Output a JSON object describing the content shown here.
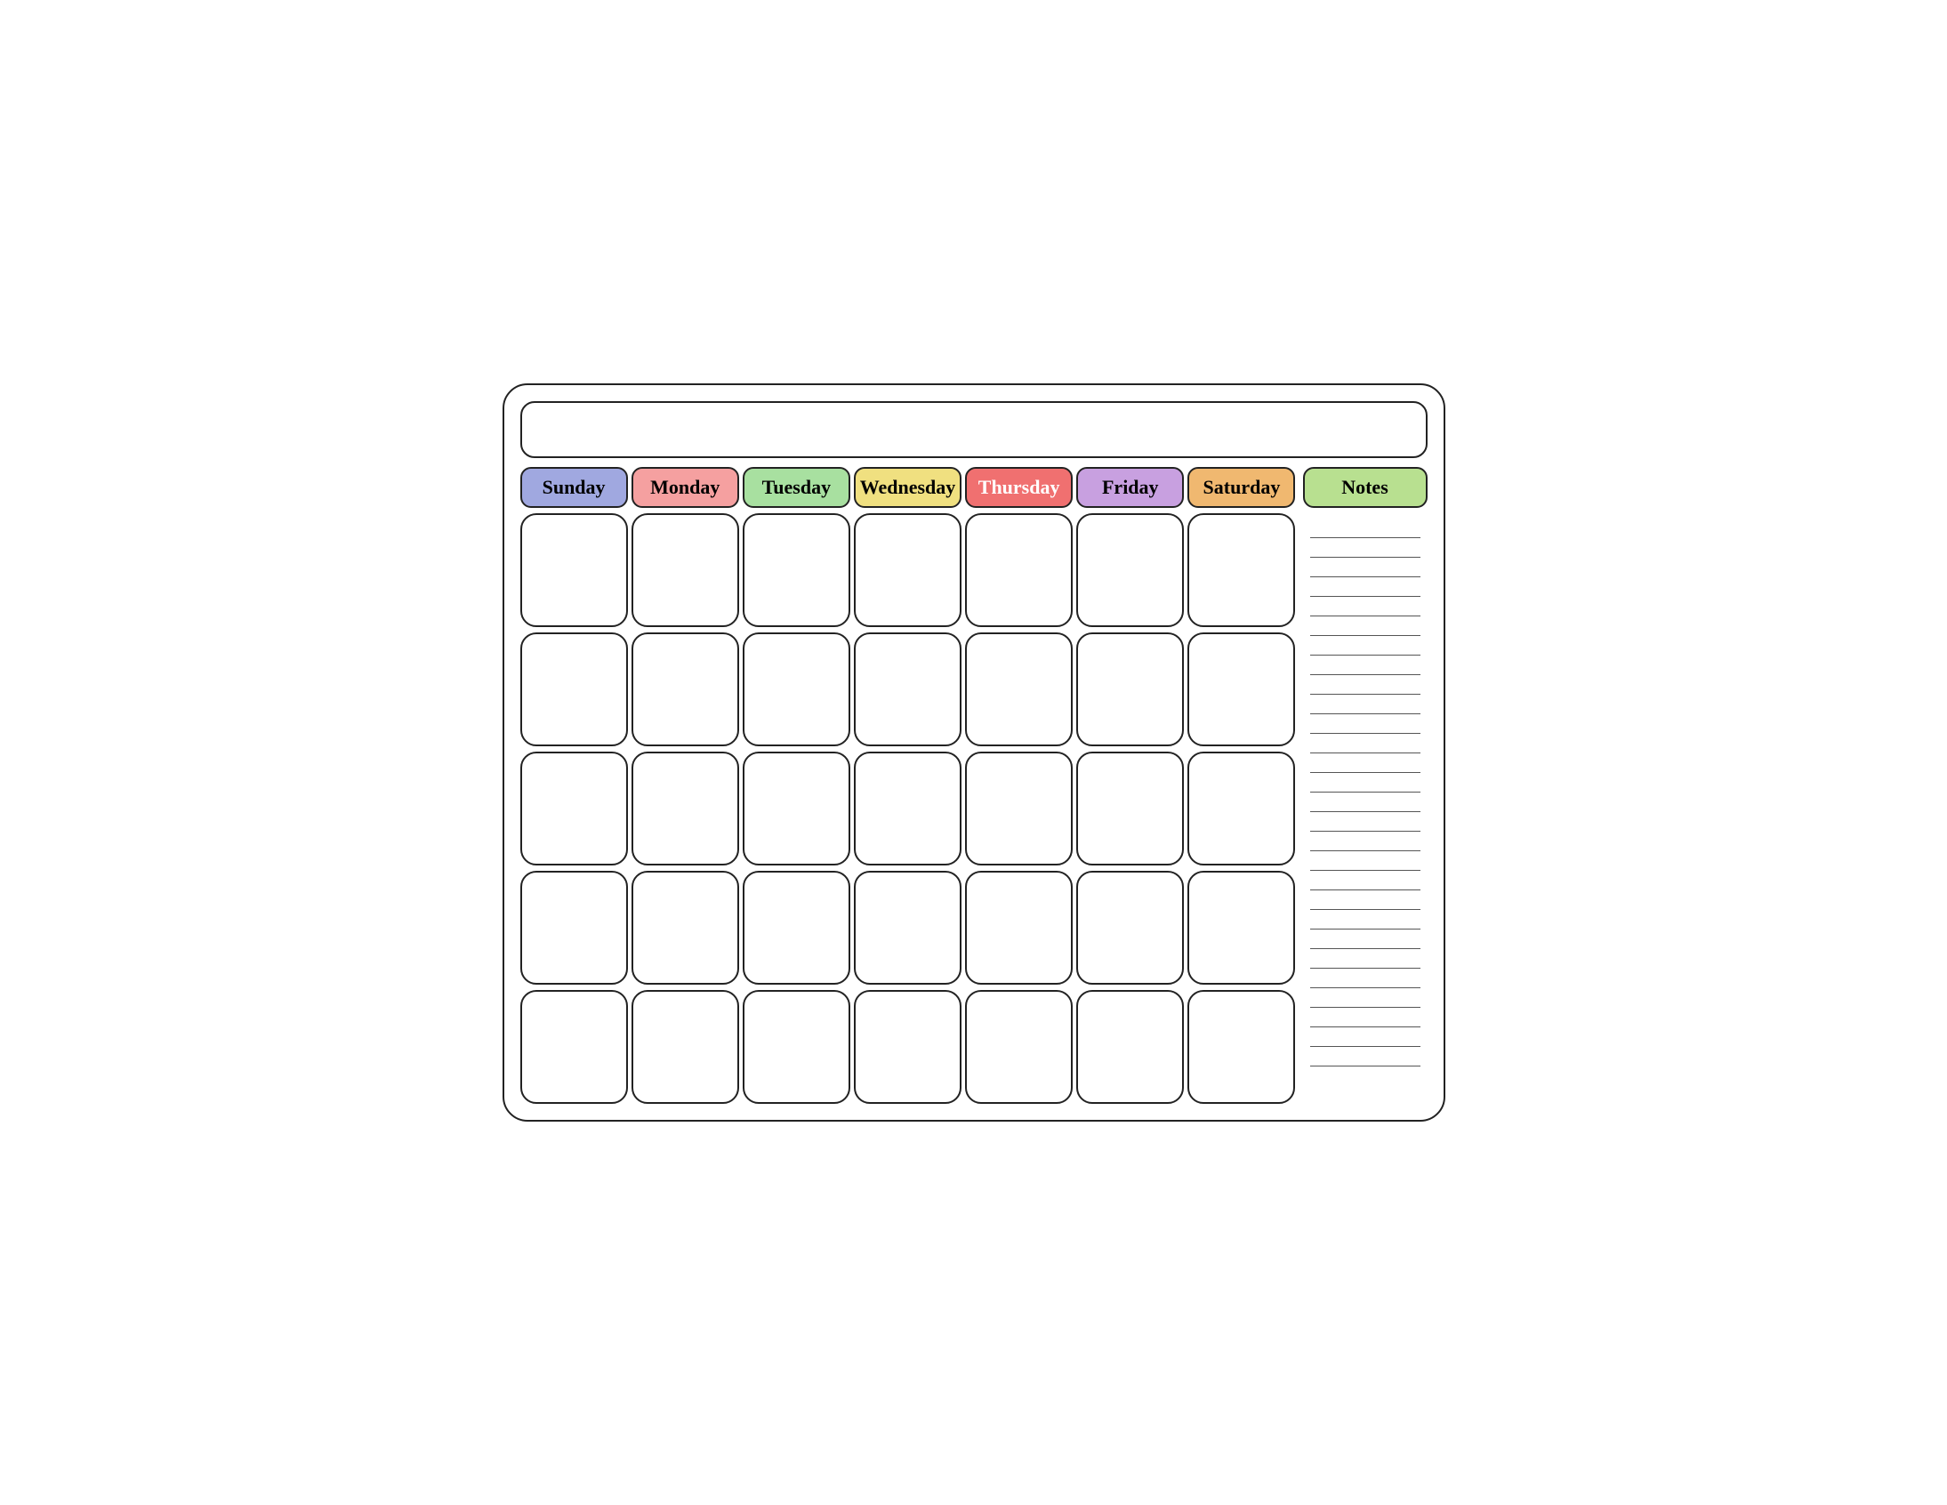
{
  "calendar": {
    "title": "",
    "days": [
      "Sunday",
      "Monday",
      "Tuesday",
      "Wednesday",
      "Thursday",
      "Friday",
      "Saturday"
    ],
    "dayClasses": [
      "sunday",
      "monday",
      "tuesday",
      "wednesday",
      "thursday",
      "friday",
      "saturday"
    ],
    "notes_label": "Notes",
    "rows": 5,
    "notes_lines": 28
  }
}
